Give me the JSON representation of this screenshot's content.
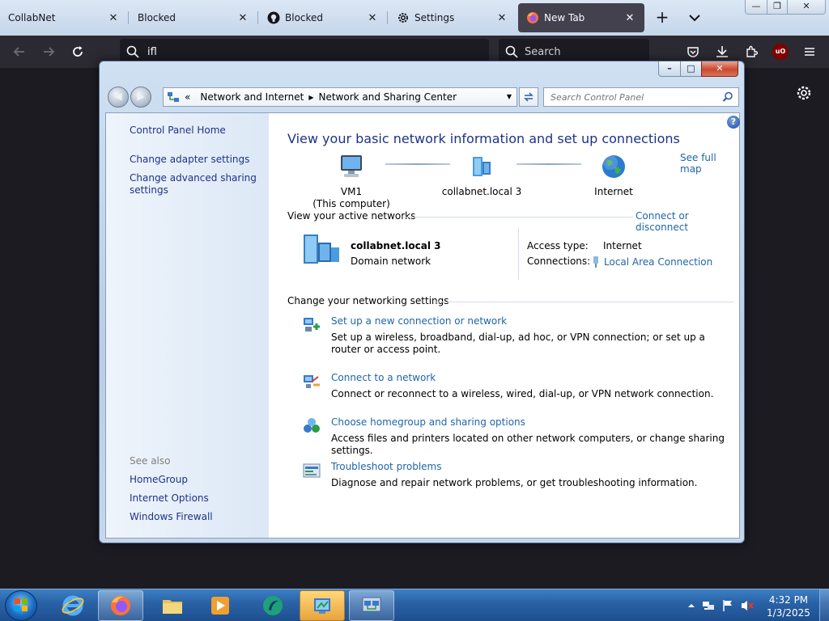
{
  "browser": {
    "tabs": [
      {
        "label": "CollabNet",
        "icon": "none"
      },
      {
        "label": "Blocked",
        "icon": "none"
      },
      {
        "label": "Blocked",
        "icon": "github-icon"
      },
      {
        "label": "Settings",
        "icon": "gear-icon"
      },
      {
        "label": "New Tab",
        "icon": "firefox-icon",
        "active": true
      }
    ],
    "url_text": "ifl",
    "search_placeholder": "Search",
    "ublock_badge": "uO"
  },
  "window": {
    "breadcrumbs": [
      "Network and Internet",
      "Network and Sharing Center"
    ],
    "search_placeholder": "Search Control Panel",
    "buttons": {
      "min": "–",
      "max": "□",
      "close": "✕"
    }
  },
  "sidebar": {
    "items": [
      "Control Panel Home",
      "Change adapter settings",
      "Change advanced sharing settings"
    ],
    "see_also_heading": "See also",
    "see_also": [
      "HomeGroup",
      "Internet Options",
      "Windows Firewall"
    ]
  },
  "main": {
    "title": "View your basic network information and set up connections",
    "see_full_map": "See full map",
    "map_nodes": [
      {
        "name": "VM1",
        "sub": "(This computer)"
      },
      {
        "name": "collabnet.local  3",
        "sub": ""
      },
      {
        "name": "Internet",
        "sub": ""
      }
    ],
    "active_networks_heading": "View your active networks",
    "connect_or_disconnect": "Connect or disconnect",
    "network": {
      "name": "collabnet.local  3",
      "type": "Domain network",
      "access_type_label": "Access type:",
      "access_type_value": "Internet",
      "connections_label": "Connections:",
      "connections_value": "Local Area Connection"
    },
    "change_settings_heading": "Change your networking settings",
    "tasks": [
      {
        "title": "Set up a new connection or network",
        "desc": "Set up a wireless, broadband, dial-up, ad hoc, or VPN connection; or set up a router or access point."
      },
      {
        "title": "Connect to a network",
        "desc": "Connect or reconnect to a wireless, wired, dial-up, or VPN network connection."
      },
      {
        "title": "Choose homegroup and sharing options",
        "desc": "Access files and printers located on other network computers, or change sharing settings."
      },
      {
        "title": "Troubleshoot problems",
        "desc": "Diagnose and repair network problems, or get troubleshooting information."
      }
    ]
  },
  "taskbar": {
    "apps": [
      "start-orb",
      "internet-explorer-icon",
      "firefox-icon",
      "file-explorer-icon",
      "media-player-icon",
      "app-icon",
      "control-panel-icon",
      "network-window-icon"
    ],
    "time": "4:32 PM",
    "date": "1/3/2025"
  },
  "colors": {
    "link": "#1e66aa",
    "title": "#1e3287",
    "active_tab": "#42414d",
    "firefox_toolbar": "#2b2a33"
  }
}
